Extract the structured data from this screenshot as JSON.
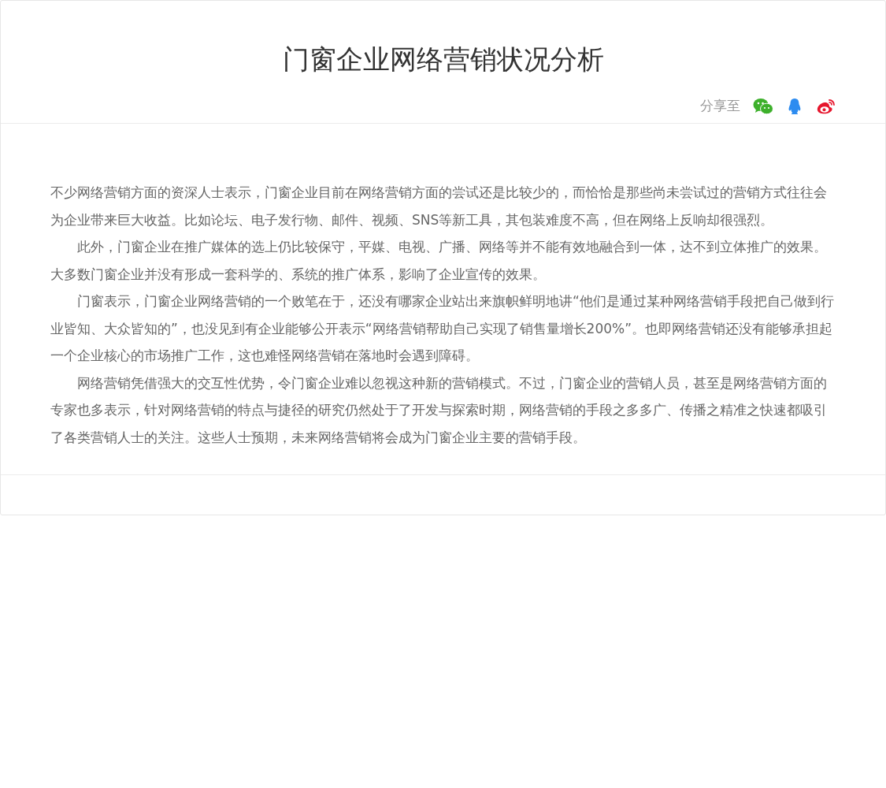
{
  "article": {
    "title": "门窗企业网络营销状况分析",
    "share": {
      "label": "分享至",
      "icons": [
        {
          "kind": "wechat"
        },
        {
          "kind": "qq"
        },
        {
          "kind": "weibo"
        }
      ]
    },
    "paragraphs": [
      {
        "indented": false,
        "text": "不少网络营销方面的资深人士表示，门窗企业目前在网络营销方面的尝试还是比较少的，而恰恰是那些尚未尝试过的营销方式往往会为企业带来巨大收益。比如论坛、电子发行物、邮件、视频、SNS等新工具，其包装难度不高，但在网络上反响却很强烈。"
      },
      {
        "indented": true,
        "text": "此外，门窗企业在推广媒体的选上仍比较保守，平媒、电视、广播、网络等并不能有效地融合到一体，达不到立体推广的效果。大多数门窗企业并没有形成一套科学的、系统的推广体系，影响了企业宣传的效果。"
      },
      {
        "indented": true,
        "text": "门窗表示，门窗企业网络营销的一个败笔在于，还没有哪家企业站出来旗帜鲜明地讲“他们是通过某种网络营销手段把自己做到行业皆知、大众皆知的”，也没见到有企业能够公开表示“网络营销帮助自己实现了销售量增长200%”。也即网络营销还没有能够承担起一个企业核心的市场推广工作，这也难怪网络营销在落地时会遇到障碍。"
      },
      {
        "indented": true,
        "text": "网络营销凭借强大的交互性优势，令门窗企业难以忽视这种新的营销模式。不过，门窗企业的营销人员，甚至是网络营销方面的专家也多表示，针对网络营销的特点与捷径的研究仍然处于了开发与探索时期，网络营销的手段之多多广、传播之精准之快速都吸引了各类营销人士的关注。这些人士预期，未来网络营销将会成为门窗企业主要的营销手段。"
      }
    ]
  }
}
